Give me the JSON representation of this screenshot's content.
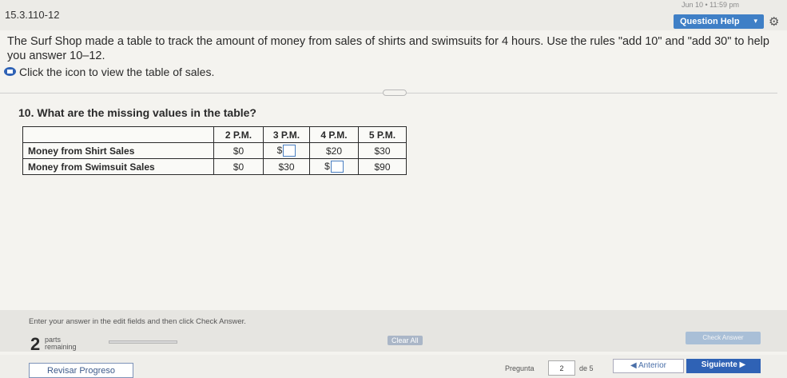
{
  "header": {
    "date_text": "Jun 10 • 11:59 pm",
    "problem_id": "15.3.110-12",
    "help_label": "Question Help",
    "help_caret": "▾",
    "gear_icon": "⚙"
  },
  "question": {
    "text": "The Surf Shop made a table to track the amount of money from sales of shirts and swimsuits for 4 hours. Use the rules \"add 10\" and \"add 30\" to help you answer 10–12.",
    "link_text": "Click the icon to view the table of sales.",
    "sub_question": "10. What are the missing values in the table?"
  },
  "table": {
    "headers": [
      "",
      "2 P.M.",
      "3 P.M.",
      "4 P.M.",
      "5 P.M."
    ],
    "rows": [
      {
        "label": "Money from Shirt Sales",
        "c1": "$0",
        "c2_prefix": "$",
        "c3": "$20",
        "c4": "$30"
      },
      {
        "label": "Money from Swimsuit Sales",
        "c1": "$0",
        "c2": "$30",
        "c3_prefix": "$",
        "c4": "$90"
      }
    ]
  },
  "footer": {
    "instruction": "Enter your answer in the edit fields and then click Check Answer.",
    "parts_count": "2",
    "parts_label_1": "parts",
    "parts_label_2": "remaining",
    "clear_all": "Clear All",
    "check_answer": "Check Answer"
  },
  "nav": {
    "review": "Revisar Progreso",
    "pregunta_label": "Pregunta",
    "pregunta_value": "2",
    "de_label": "de 5",
    "prev": "◀ Anterior",
    "next": "Siguiente ▶"
  },
  "colors": {
    "accent": "#2f62b5",
    "help_button": "#3f7fc6"
  }
}
